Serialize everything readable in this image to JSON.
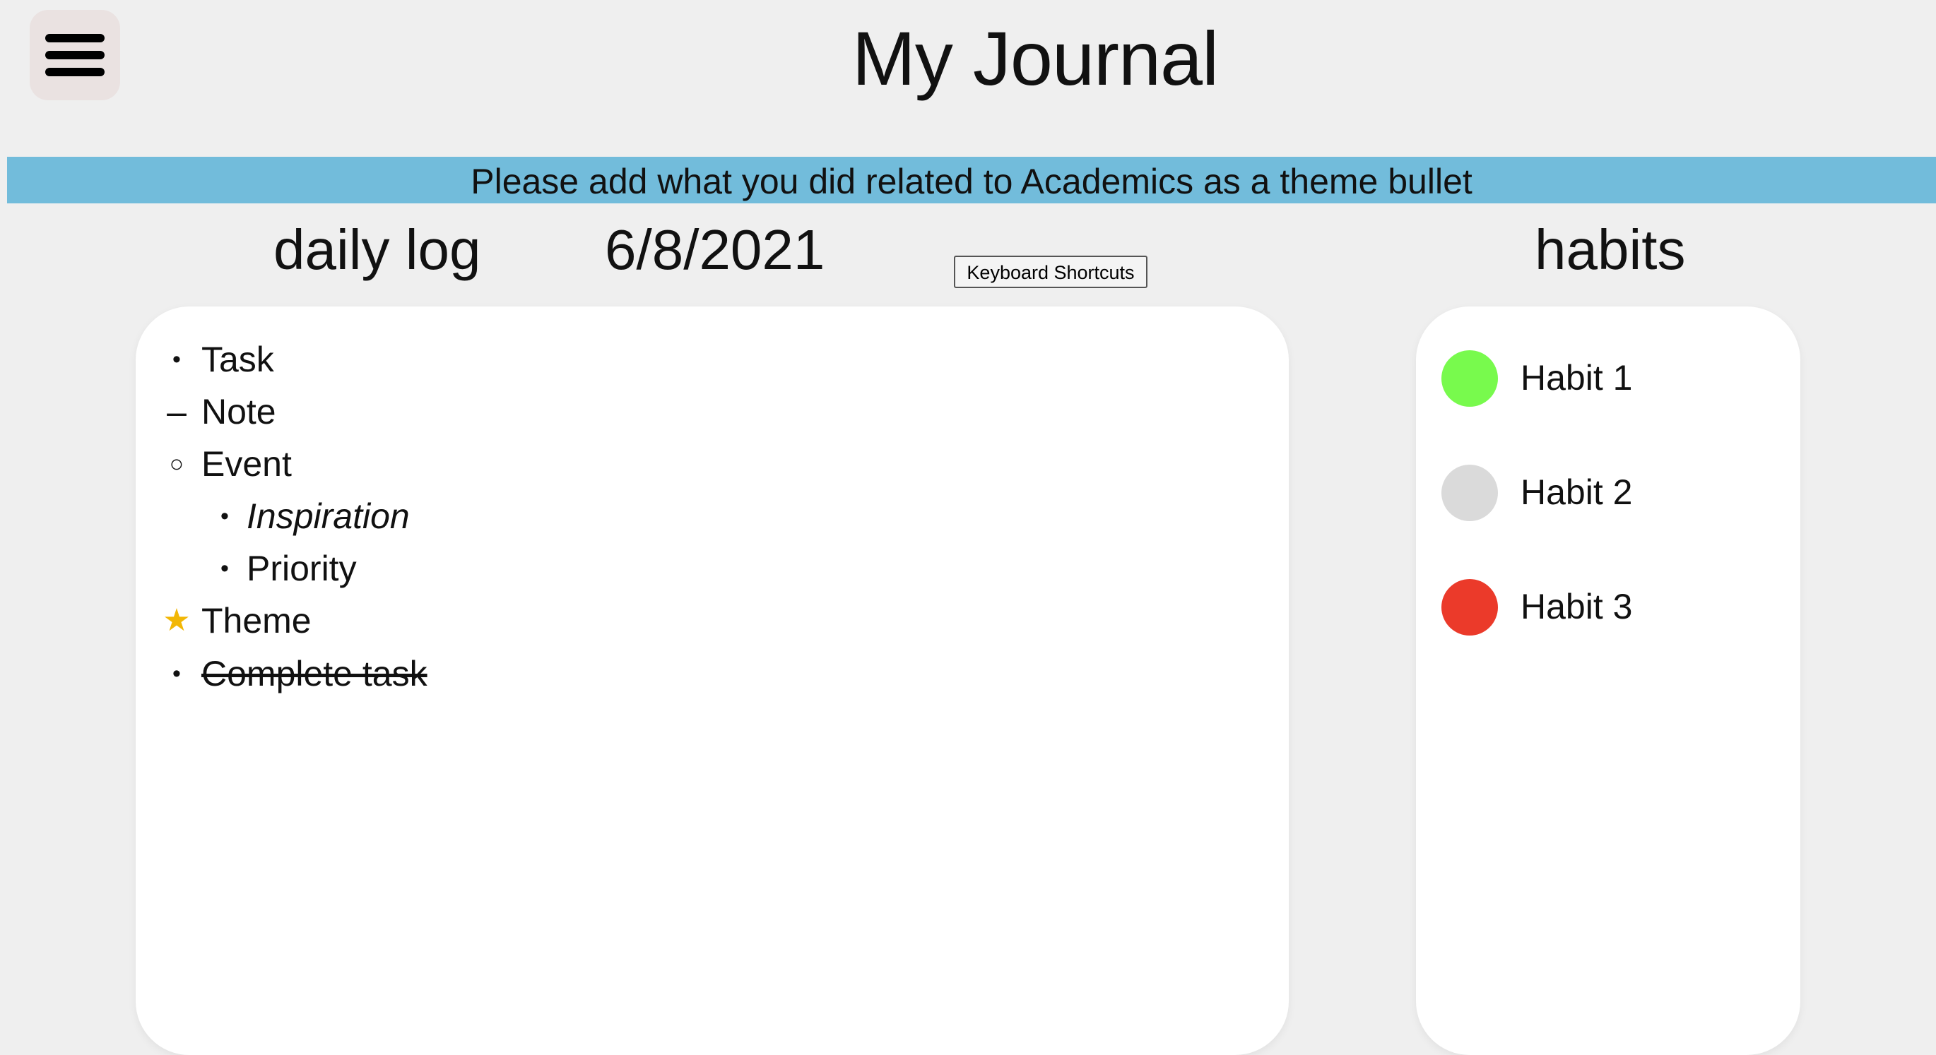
{
  "header": {
    "title": "My Journal",
    "menu_icon": "hamburger-menu-icon"
  },
  "banner": {
    "text": "Please add what you did related to Academics as a theme bullet",
    "color": "#72bcdb"
  },
  "daily_log": {
    "heading": "daily log",
    "date": "6/8/2021",
    "shortcuts_label": "Keyboard Shortcuts",
    "entries": [
      {
        "symbol": "•",
        "text": "Task",
        "type": "task"
      },
      {
        "symbol": "–",
        "text": "Note",
        "type": "note"
      },
      {
        "symbol": "○",
        "text": "Event",
        "type": "event"
      },
      {
        "symbol": "•",
        "text": "Inspiration",
        "type": "inspiration"
      },
      {
        "symbol": "•",
        "text": "Priority",
        "type": "priority"
      },
      {
        "symbol": "★",
        "text": "Theme",
        "type": "theme"
      },
      {
        "symbol": "•",
        "text": "Complete task",
        "type": "completed-task"
      }
    ]
  },
  "habits": {
    "heading": "habits",
    "items": [
      {
        "label": "Habit 1",
        "color": "#78fa4d"
      },
      {
        "label": "Habit 2",
        "color": "#dadada"
      },
      {
        "label": "Habit 3",
        "color": "#eb3a2a"
      }
    ]
  }
}
